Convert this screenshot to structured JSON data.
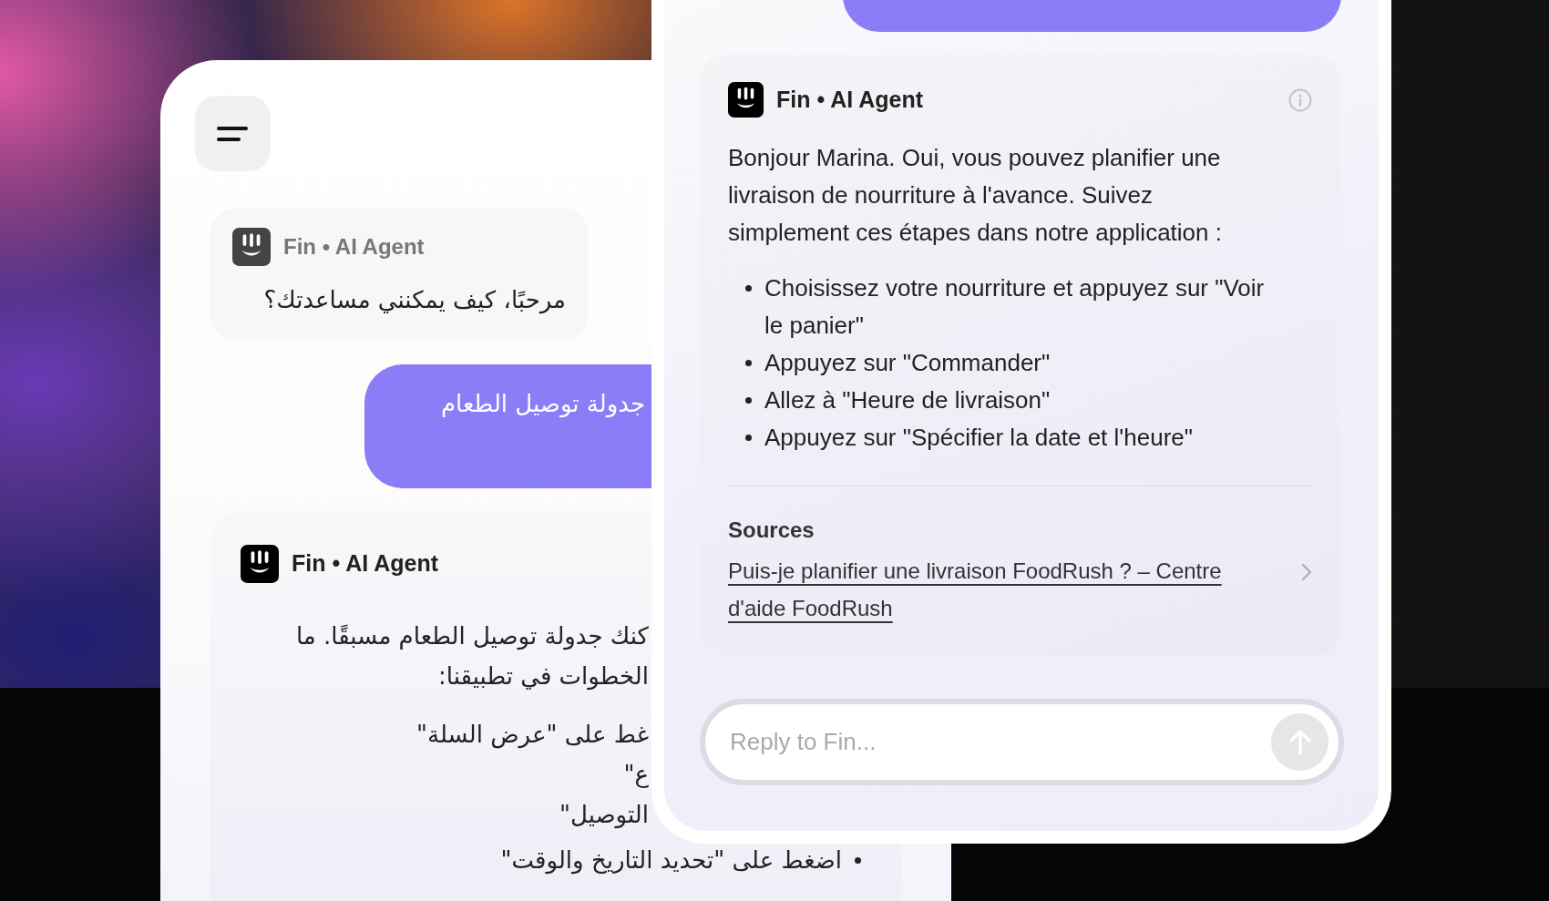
{
  "greeting_card": {
    "sender": "Fin • AI Agent",
    "text": "مرحبًا، كيف يمكنني مساعدتك؟"
  },
  "user_bubble": {
    "text": "جدولة توصيل الطعام"
  },
  "arabic_reply": {
    "sender": "Fin • AI Agent",
    "lines": [
      "كنك جدولة توصيل الطعام مسبقًا. ما",
      "الخطوات في تطبيقنا:"
    ],
    "steps": [
      {
        "text": "غط على \"عرض السلة\"",
        "bullet": false
      },
      {
        "text": "ع\"",
        "bullet": false
      },
      {
        "text": "التوصيل\"",
        "bullet": false
      },
      {
        "text": "اضغط على \"تحديد التاريخ والوقت\"",
        "bullet": true
      }
    ]
  },
  "french_reply": {
    "sender": "Fin • AI Agent",
    "text": "Bonjour Marina. Oui, vous pouvez planifier une livraison de nourriture à l'avance. Suivez simplement ces étapes dans notre application :",
    "steps": [
      "Choisissez votre nourriture et appuyez sur \"Voir le panier\"",
      "Appuyez sur \"Commander\"",
      "Allez à \"Heure de livraison\"",
      "Appuyez sur \"Spécifier la date et l'heure\""
    ],
    "sources_title": "Sources",
    "source_link": "Puis-je planifier une livraison FoodRush ? – Centre d'aide FoodRush"
  },
  "composer": {
    "placeholder": "Reply to Fin..."
  }
}
